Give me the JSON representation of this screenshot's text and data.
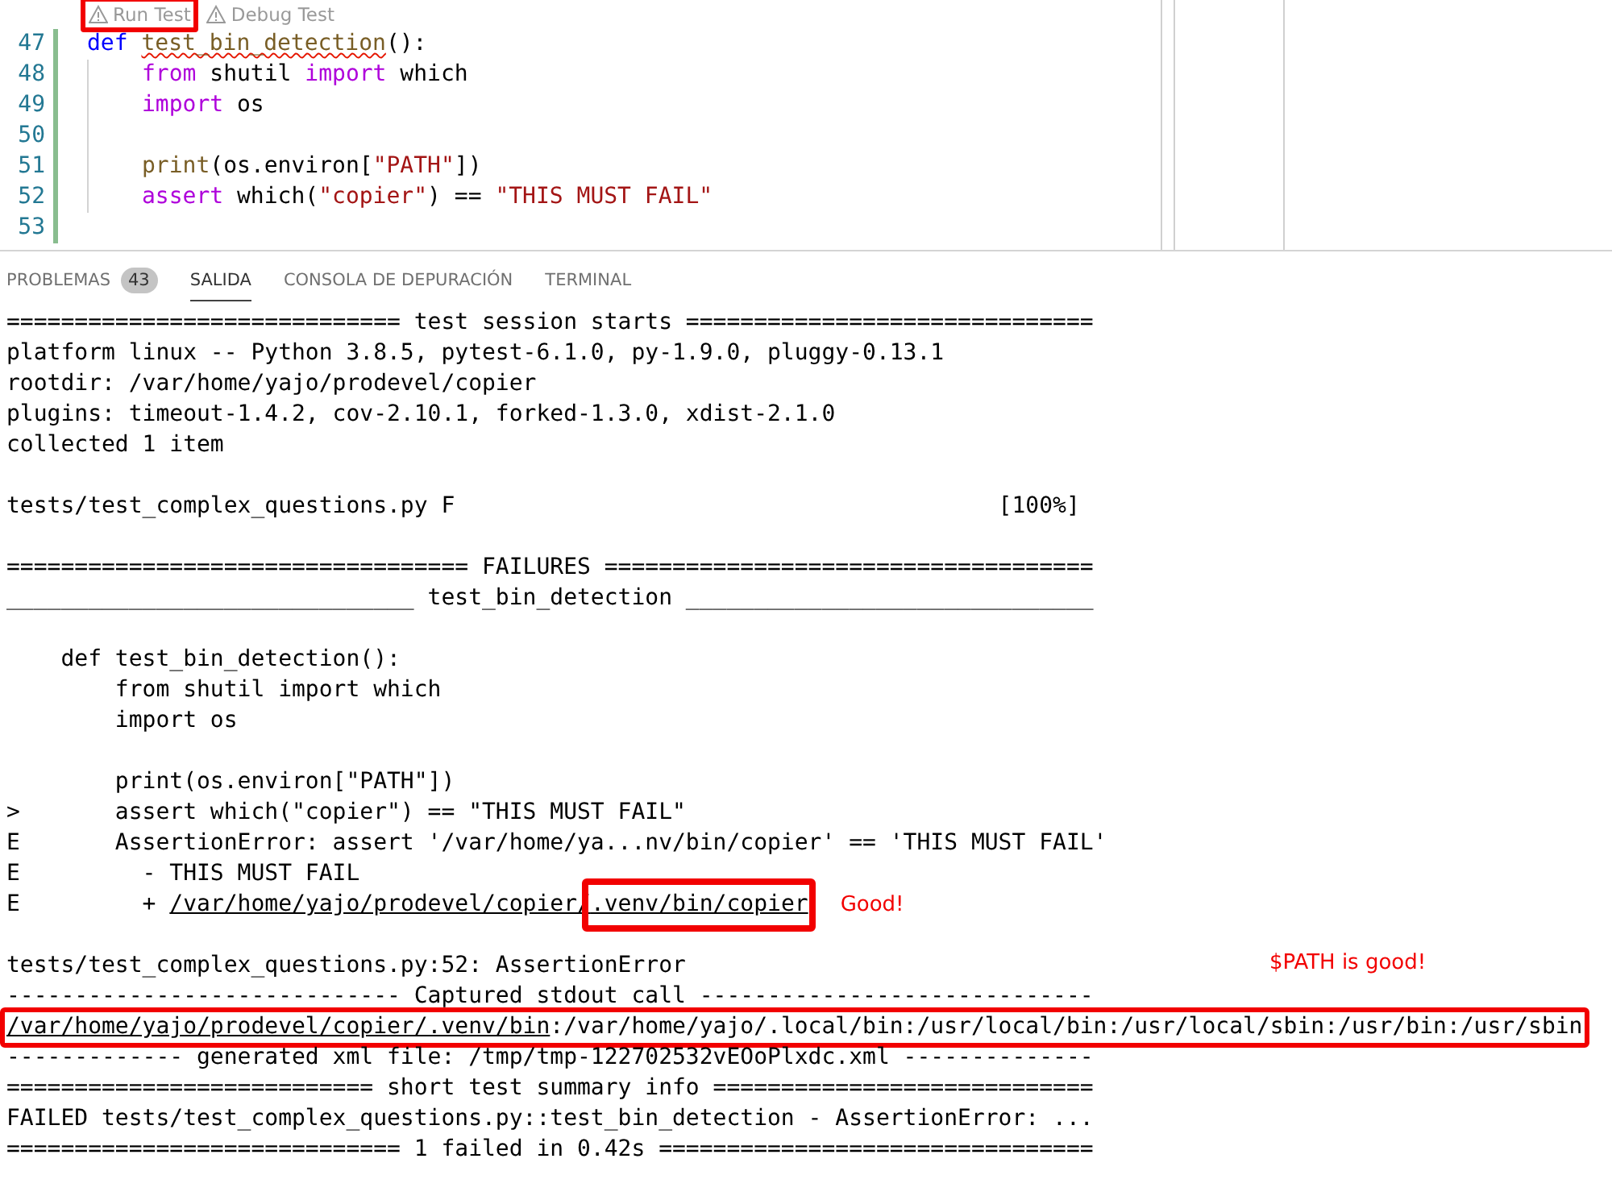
{
  "editor": {
    "codelens": [
      {
        "label": "Run Test",
        "highlighted": true
      },
      {
        "label": "Debug Test",
        "highlighted": false
      }
    ],
    "lines": [
      {
        "number": "47",
        "guide": false,
        "tokens": [
          {
            "text": "def ",
            "kind": "keyword",
            "squiggle": false
          },
          {
            "text": "test_bin_detection",
            "kind": "function",
            "squiggle": true
          },
          {
            "text": "():",
            "kind": "plain",
            "squiggle": false
          }
        ]
      },
      {
        "number": "48",
        "guide": true,
        "tokens": [
          {
            "text": "from",
            "kind": "control",
            "squiggle": false
          },
          {
            "text": " shutil ",
            "kind": "plain",
            "squiggle": false
          },
          {
            "text": "import",
            "kind": "control",
            "squiggle": false
          },
          {
            "text": " which",
            "kind": "plain",
            "squiggle": false
          }
        ]
      },
      {
        "number": "49",
        "guide": true,
        "tokens": [
          {
            "text": "import",
            "kind": "control",
            "squiggle": false
          },
          {
            "text": " os",
            "kind": "plain",
            "squiggle": false
          }
        ]
      },
      {
        "number": "50",
        "guide": true
      },
      {
        "number": "51",
        "guide": true,
        "tokens": [
          {
            "text": "print",
            "kind": "function",
            "squiggle": false
          },
          {
            "text": "(os.environ[",
            "kind": "plain",
            "squiggle": false
          },
          {
            "text": "\"PATH\"",
            "kind": "string",
            "squiggle": false
          },
          {
            "text": "])",
            "kind": "plain",
            "squiggle": false
          }
        ]
      },
      {
        "number": "52",
        "guide": true,
        "tokens": [
          {
            "text": "assert",
            "kind": "control",
            "squiggle": false
          },
          {
            "text": " which(",
            "kind": "plain",
            "squiggle": false
          },
          {
            "text": "\"copier\"",
            "kind": "string",
            "squiggle": false
          },
          {
            "text": ") == ",
            "kind": "plain",
            "squiggle": false
          },
          {
            "text": "\"THIS MUST FAIL\"",
            "kind": "string",
            "squiggle": false
          }
        ]
      },
      {
        "number": "53",
        "guide": false
      }
    ]
  },
  "panel": {
    "tabs": [
      {
        "label": "PROBLEMAS",
        "badge": "43",
        "selected": false
      },
      {
        "label": "SALIDA",
        "selected": true
      },
      {
        "label": "CONSOLA DE DEPURACIÓN",
        "selected": false
      },
      {
        "label": "TERMINAL",
        "selected": false
      }
    ],
    "output": [
      {
        "kind": "text",
        "boxed": false,
        "parts": [
          {
            "text": "============================= test session starts ==============================",
            "underline": false
          }
        ]
      },
      {
        "kind": "text",
        "boxed": false,
        "parts": [
          {
            "text": "platform linux -- Python 3.8.5, pytest-6.1.0, py-1.9.0, pluggy-0.13.1",
            "underline": false
          }
        ]
      },
      {
        "kind": "text",
        "boxed": false,
        "parts": [
          {
            "text": "rootdir: /var/home/yajo/prodevel/copier",
            "underline": false
          }
        ]
      },
      {
        "kind": "text",
        "boxed": false,
        "parts": [
          {
            "text": "plugins: timeout-1.4.2, cov-2.10.1, forked-1.3.0, xdist-2.1.0",
            "underline": false
          }
        ]
      },
      {
        "kind": "text",
        "boxed": false,
        "parts": [
          {
            "text": "collected 1 item",
            "underline": false
          }
        ]
      },
      {
        "kind": "blank"
      },
      {
        "kind": "text",
        "boxed": false,
        "parts": [
          {
            "text": "tests/test_complex_questions.py F                                        [100%]",
            "underline": false
          }
        ]
      },
      {
        "kind": "blank"
      },
      {
        "kind": "text",
        "boxed": false,
        "parts": [
          {
            "text": "================================== FAILURES ====================================",
            "underline": false
          }
        ]
      },
      {
        "kind": "text",
        "boxed": false,
        "parts": [
          {
            "text": "______________________________ test_bin_detection ______________________________",
            "underline": false
          }
        ]
      },
      {
        "kind": "blank"
      },
      {
        "kind": "text",
        "boxed": false,
        "parts": [
          {
            "text": "    def test_bin_detection():",
            "underline": false
          }
        ]
      },
      {
        "kind": "text",
        "boxed": false,
        "parts": [
          {
            "text": "        from shutil import which",
            "underline": false
          }
        ]
      },
      {
        "kind": "text",
        "boxed": false,
        "parts": [
          {
            "text": "        import os",
            "underline": false
          }
        ]
      },
      {
        "kind": "blank"
      },
      {
        "kind": "text",
        "boxed": false,
        "parts": [
          {
            "text": "        print(os.environ[\"PATH\"])",
            "underline": false
          }
        ]
      },
      {
        "kind": "text",
        "boxed": false,
        "parts": [
          {
            "text": ">       assert which(\"copier\") == \"THIS MUST FAIL\"",
            "underline": false
          }
        ]
      },
      {
        "kind": "text",
        "boxed": false,
        "parts": [
          {
            "text": "E       AssertionError: assert '/var/home/ya...nv/bin/copier' == 'THIS MUST FAIL'",
            "underline": false
          }
        ]
      },
      {
        "kind": "text",
        "boxed": false,
        "parts": [
          {
            "text": "E         - THIS MUST FAIL",
            "underline": false
          }
        ]
      },
      {
        "kind": "text",
        "boxed": false,
        "parts": [
          {
            "text": "E         + ",
            "underline": false,
            "kind": "plain"
          },
          {
            "text": "/var/home/yajo/prodevel/copier/",
            "underline": true,
            "kind": "plain"
          },
          {
            "text": ".venv/bin/copier",
            "underline": true,
            "kind": "highlighted"
          }
        ],
        "note": {
          "text": "Good!",
          "kind": "inline"
        }
      },
      {
        "kind": "blank"
      },
      {
        "kind": "text",
        "boxed": false,
        "parts": [
          {
            "text": "tests/test_complex_questions.py:52: AssertionError",
            "underline": false
          }
        ],
        "note": {
          "text": "$PATH is good!",
          "kind": "far"
        }
      },
      {
        "kind": "text",
        "boxed": false,
        "parts": [
          {
            "text": "----------------------------- Captured stdout call -----------------------------",
            "underline": false
          }
        ]
      },
      {
        "kind": "text",
        "boxed": true,
        "parts": [
          {
            "text": "/var/home/yajo/prodevel/copier/.venv/bin",
            "underline": true
          },
          {
            "text": ":/var/home/yajo/.local/bin:/usr/local/bin:/usr/local/sbin:/usr/bin:/usr/sbin",
            "underline": false
          }
        ]
      },
      {
        "kind": "text",
        "boxed": false,
        "parts": [
          {
            "text": "------------- generated xml file: /tmp/tmp-122702532vEOoPlxdc.xml --------------",
            "underline": false
          }
        ]
      },
      {
        "kind": "text",
        "boxed": false,
        "parts": [
          {
            "text": "=========================== short test summary info ============================",
            "underline": false
          }
        ]
      },
      {
        "kind": "text",
        "boxed": false,
        "parts": [
          {
            "text": "FAILED tests/test_complex_questions.py::test_bin_detection - AssertionError: ...",
            "underline": false
          }
        ]
      },
      {
        "kind": "text",
        "boxed": false,
        "parts": [
          {
            "text": "============================= 1 failed in 0.42s ================================",
            "underline": false
          }
        ]
      }
    ]
  }
}
